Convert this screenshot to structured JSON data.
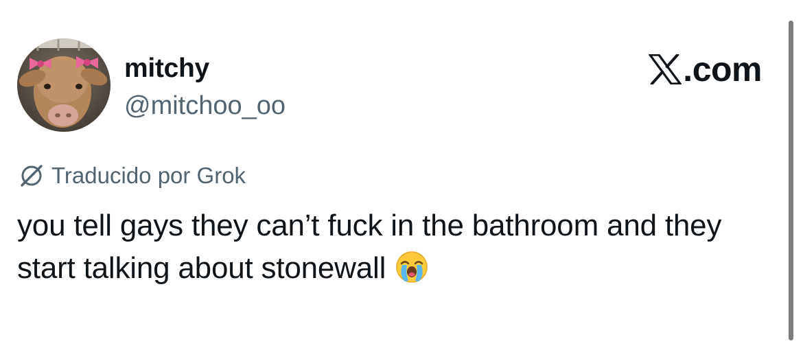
{
  "author": {
    "display_name": "mitchy",
    "handle": "@mitchoo_oo",
    "avatar_icon": "cow-with-pink-bows-avatar"
  },
  "brand": {
    "text": ".com",
    "logo_icon": "x-logo-icon"
  },
  "translation": {
    "icon": "grok-icon",
    "label": "Traducido por Grok"
  },
  "tweet": {
    "text": "you tell gays they can’t fuck in the bathroom and they start talking about stonewall",
    "emoji": "loudly-crying-face-emoji"
  },
  "colors": {
    "text_primary": "#0f1419",
    "text_secondary": "#536471",
    "background": "#ffffff"
  }
}
